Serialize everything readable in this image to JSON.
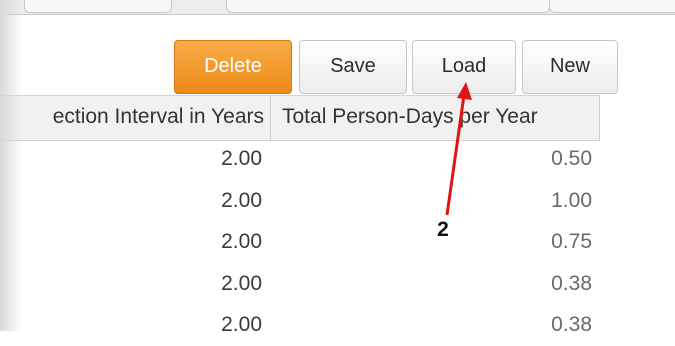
{
  "toolbar": {
    "delete_label": "Delete",
    "save_label": "Save",
    "load_label": "Load",
    "new_label": "New"
  },
  "table": {
    "columns": [
      "ection Interval in Years",
      "Total Person-Days per Year"
    ],
    "rows": [
      [
        "2.00",
        "0.50"
      ],
      [
        "2.00",
        "1.00"
      ],
      [
        "2.00",
        "0.75"
      ],
      [
        "2.00",
        "0.38"
      ],
      [
        "2.00",
        "0.38"
      ]
    ]
  },
  "annotation": {
    "label": "2",
    "color": "#e01414"
  },
  "colors": {
    "accent": "#ee9222"
  }
}
